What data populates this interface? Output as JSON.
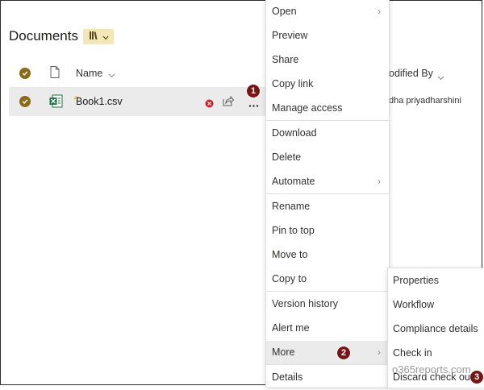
{
  "library": {
    "title": "Documents",
    "view_icon": "library-books-icon"
  },
  "columns": {
    "name": "Name",
    "modified_by": "odified By"
  },
  "row": {
    "filename": "Book1.csv",
    "modified_by": "dha priyadharshini"
  },
  "context_menu": {
    "items": [
      {
        "label": "Open",
        "has_submenu": true
      },
      {
        "label": "Preview"
      },
      {
        "label": "Share"
      },
      {
        "label": "Copy link"
      },
      {
        "label": "Manage access"
      },
      {
        "label": "Download"
      },
      {
        "label": "Delete"
      },
      {
        "label": "Automate",
        "has_submenu": true
      },
      {
        "label": "Rename"
      },
      {
        "label": "Pin to top"
      },
      {
        "label": "Move to"
      },
      {
        "label": "Copy to"
      },
      {
        "label": "Version history"
      },
      {
        "label": "Alert me"
      },
      {
        "label": "More",
        "has_submenu": true,
        "highlighted": true
      },
      {
        "label": "Details"
      }
    ]
  },
  "submenu": {
    "items": [
      {
        "label": "Properties"
      },
      {
        "label": "Workflow"
      },
      {
        "label": "Compliance details"
      },
      {
        "label": "Check in"
      },
      {
        "label": "Discard check out"
      }
    ]
  },
  "callouts": [
    "1",
    "2",
    "3"
  ],
  "watermark": "o365reports.com",
  "colors": {
    "accent": "#8b6a1a",
    "badge": "#7a1414",
    "highlight": "#ebebeb",
    "excel": "#1f7244"
  }
}
